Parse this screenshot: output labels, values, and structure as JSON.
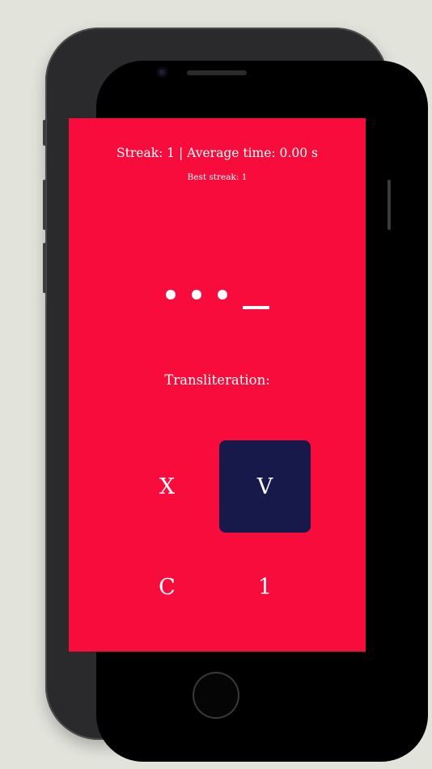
{
  "stats": {
    "streak_line": "Streak: 1 | Average time: 0.00 s",
    "best_streak": "Best streak: 1"
  },
  "morse": {
    "symbols": [
      "dot",
      "dot",
      "dot",
      "dash"
    ]
  },
  "transliteration_label": "Transliteration:",
  "answers": [
    {
      "label": "X",
      "selected": false
    },
    {
      "label": "V",
      "selected": true
    },
    {
      "label": "C",
      "selected": false
    },
    {
      "label": "1",
      "selected": false
    }
  ],
  "colors": {
    "screen_background": "#f80c3c",
    "selected_tile": "#16194a",
    "text": "#ffffff",
    "page_background": "#e2e4dc"
  }
}
